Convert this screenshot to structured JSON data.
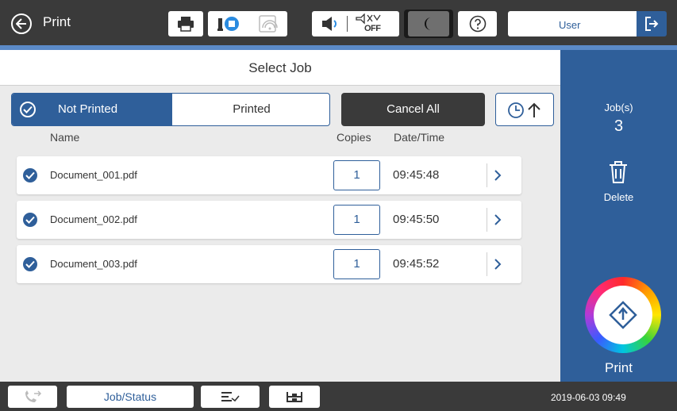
{
  "topbar": {
    "title": "Print",
    "user_label": "User",
    "status_icons": [
      "printer-icon",
      "ink-icon",
      "wifi-icon",
      "volume-icon",
      "mute-off-icon",
      "sleep-icon",
      "help-icon"
    ],
    "off_label": "OFF"
  },
  "header": {
    "title": "Select Job"
  },
  "filter": {
    "not_printed_label": "Not Printed",
    "printed_label": "Printed",
    "selected": "Not Printed"
  },
  "cancel_all_label": "Cancel All",
  "columns": {
    "name": "Name",
    "copies": "Copies",
    "datetime": "Date/Time"
  },
  "jobs": [
    {
      "name": "Document_001.pdf",
      "copies": "1",
      "time": "09:45:48",
      "checked": true
    },
    {
      "name": "Document_002.pdf",
      "copies": "1",
      "time": "09:45:50",
      "checked": true
    },
    {
      "name": "Document_003.pdf",
      "copies": "1",
      "time": "09:45:52",
      "checked": true
    }
  ],
  "sidebar": {
    "jobs_label": "Job(s)",
    "jobs_count": "3",
    "delete_label": "Delete",
    "print_label": "Print"
  },
  "bottombar": {
    "job_status_label": "Job/Status",
    "datetime": "2019-06-03 09:49"
  },
  "colors": {
    "accent_blue": "#2f5f9a",
    "light_blue": "#5b8ac7",
    "dark_bar": "#3a3a3a",
    "list_bg": "#ebebeb"
  }
}
